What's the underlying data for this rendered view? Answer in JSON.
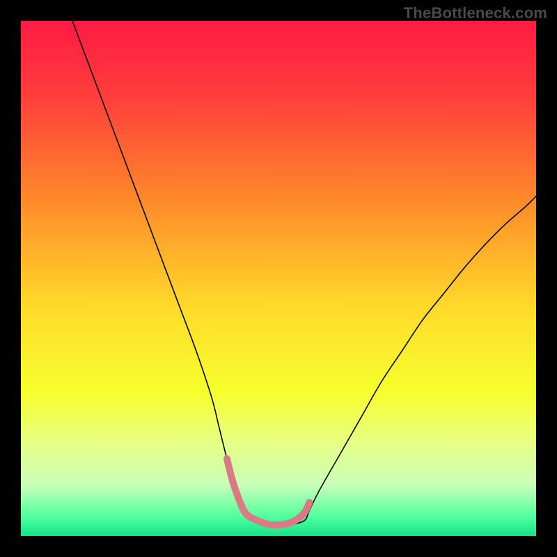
{
  "watermark": "TheBottleneck.com",
  "chart_data": {
    "type": "line",
    "title": "",
    "xlabel": "",
    "ylabel": "",
    "xlim": [
      0,
      100
    ],
    "ylim": [
      0,
      100
    ],
    "grid": false,
    "legend": false,
    "gradient_stops": [
      {
        "offset": 0.0,
        "color": "#ff1a44"
      },
      {
        "offset": 0.15,
        "color": "#ff3f3b"
      },
      {
        "offset": 0.35,
        "color": "#ff8a2a"
      },
      {
        "offset": 0.55,
        "color": "#ffd92a"
      },
      {
        "offset": 0.72,
        "color": "#f6ff2d"
      },
      {
        "offset": 0.82,
        "color": "#e7ff86"
      },
      {
        "offset": 0.9,
        "color": "#c9ffb9"
      },
      {
        "offset": 0.965,
        "color": "#4cff9d"
      },
      {
        "offset": 1.0,
        "color": "#16e08a"
      }
    ],
    "series": [
      {
        "name": "bottleneck-curve",
        "stroke": "#000000",
        "stroke_width": 1.6,
        "x": [
          10,
          13,
          16,
          19,
          22,
          25,
          28,
          31,
          34,
          37,
          38.5,
          40,
          41.5,
          43,
          46,
          49,
          52,
          55,
          56,
          58,
          62,
          66,
          70,
          74,
          78,
          82,
          86,
          90,
          94,
          98,
          100
        ],
        "y": [
          100,
          92,
          84,
          76,
          68,
          60,
          52,
          44,
          36,
          27,
          21,
          15,
          10,
          6,
          3.2,
          2.2,
          2.2,
          3.0,
          5,
          9,
          16,
          23,
          30,
          36,
          42,
          47,
          52,
          56.5,
          60.5,
          64,
          66
        ]
      },
      {
        "name": "bottom-highlight",
        "stroke": "#d97a84",
        "stroke_width": 10,
        "linecap": "round",
        "x": [
          40,
          41,
          42,
          43,
          44,
          46,
          48,
          50,
          52,
          53.5,
          55,
          56
        ],
        "y": [
          15,
          11,
          8,
          5.5,
          4,
          3,
          2.3,
          2.2,
          2.5,
          3.2,
          4.5,
          6.5
        ]
      }
    ]
  }
}
